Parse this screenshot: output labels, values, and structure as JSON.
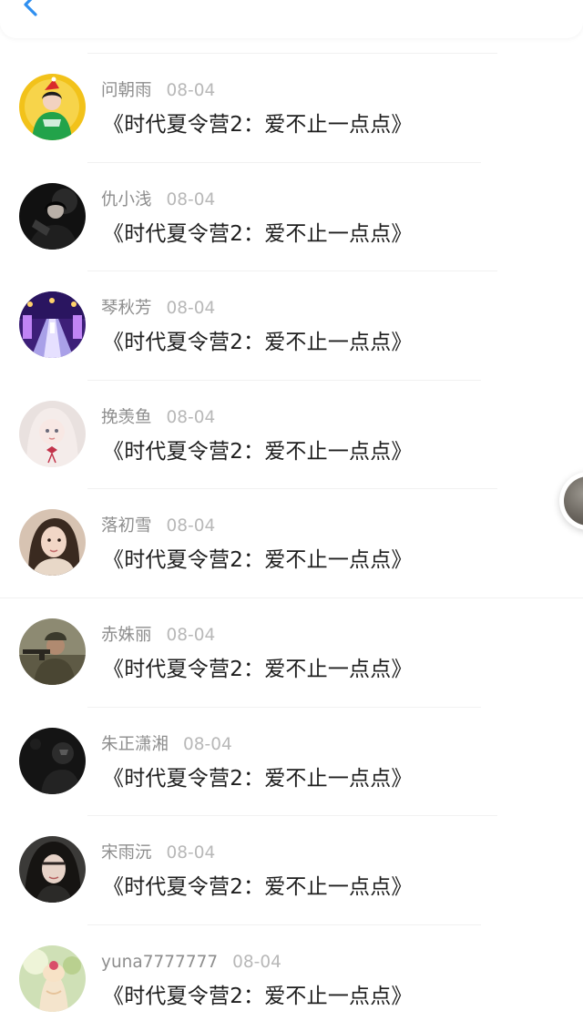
{
  "header": {
    "back_icon": "chevron-left-icon",
    "accent_color": "#2f8ff0"
  },
  "comments": [
    {
      "user": "问朝雨",
      "date": "08-04",
      "text": "《时代夏令营2：爱不止一点点》",
      "avatar": "green-costume-avatar"
    },
    {
      "user": "仇小浅",
      "date": "08-04",
      "text": "《时代夏令营2：爱不止一点点》",
      "avatar": "dark-portrait-avatar"
    },
    {
      "user": "琴秋芳",
      "date": "08-04",
      "text": "《时代夏令营2：爱不止一点点》",
      "avatar": "purple-hall-avatar"
    },
    {
      "user": "挽羡鱼",
      "date": "08-04",
      "text": "《时代夏令营2：爱不止一点点》",
      "avatar": "pale-doll-avatar"
    },
    {
      "user": "落初雪",
      "date": "08-04",
      "text": "《时代夏令营2：爱不止一点点》",
      "avatar": "selfie-girl-avatar"
    },
    {
      "user": "赤姝丽",
      "date": "08-04",
      "text": "《时代夏令营2：爱不止一点点》",
      "avatar": "soldier-avatar"
    },
    {
      "user": "朱正潇湘",
      "date": "08-04",
      "text": "《时代夏令营2：爱不止一点点》",
      "avatar": "dark-figure-avatar"
    },
    {
      "user": "宋雨沅",
      "date": "08-04",
      "text": "《时代夏令营2：爱不止一点点》",
      "avatar": "selfie-woman-avatar"
    },
    {
      "user": "yuna7777777",
      "date": "08-04",
      "text": "《时代夏令营2：爱不止一点点》",
      "avatar": "dessert-avatar"
    }
  ],
  "floating_avatar": {
    "icon": "user-avatar-icon"
  }
}
